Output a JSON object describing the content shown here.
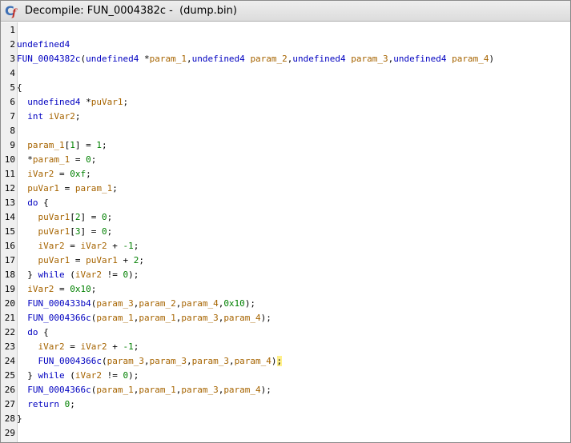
{
  "window": {
    "title": "Decompile: FUN_0004382c -  (dump.bin)",
    "icon": "decompile-icon",
    "icon_letters": [
      "C",
      "f"
    ]
  },
  "editor": {
    "lines": [
      {
        "n": "1",
        "tokens": []
      },
      {
        "n": "2",
        "tokens": [
          {
            "t": "undefined4",
            "c": "type"
          }
        ]
      },
      {
        "n": "3",
        "tokens": [
          {
            "t": "FUN_0004382c",
            "c": "func"
          },
          {
            "t": "(",
            "c": "p"
          },
          {
            "t": "undefined4",
            "c": "type"
          },
          {
            "t": " *",
            "c": "p"
          },
          {
            "t": "param_1",
            "c": "var"
          },
          {
            "t": ",",
            "c": "p"
          },
          {
            "t": "undefined4",
            "c": "type"
          },
          {
            "t": " ",
            "c": "p"
          },
          {
            "t": "param_2",
            "c": "var"
          },
          {
            "t": ",",
            "c": "p"
          },
          {
            "t": "undefined4",
            "c": "type"
          },
          {
            "t": " ",
            "c": "p"
          },
          {
            "t": "param_3",
            "c": "var"
          },
          {
            "t": ",",
            "c": "p"
          },
          {
            "t": "undefined4",
            "c": "type"
          },
          {
            "t": " ",
            "c": "p"
          },
          {
            "t": "param_4",
            "c": "var"
          },
          {
            "t": ")",
            "c": "p"
          }
        ]
      },
      {
        "n": "4",
        "tokens": []
      },
      {
        "n": "5",
        "tokens": [
          {
            "t": "{",
            "c": "p"
          }
        ]
      },
      {
        "n": "6",
        "tokens": [
          {
            "t": "  ",
            "c": "p"
          },
          {
            "t": "undefined4",
            "c": "type"
          },
          {
            "t": " *",
            "c": "p"
          },
          {
            "t": "puVar1",
            "c": "var"
          },
          {
            "t": ";",
            "c": "p"
          }
        ]
      },
      {
        "n": "7",
        "tokens": [
          {
            "t": "  ",
            "c": "p"
          },
          {
            "t": "int",
            "c": "type"
          },
          {
            "t": " ",
            "c": "p"
          },
          {
            "t": "iVar2",
            "c": "var"
          },
          {
            "t": ";",
            "c": "p"
          }
        ]
      },
      {
        "n": "8",
        "tokens": []
      },
      {
        "n": "9",
        "tokens": [
          {
            "t": "  ",
            "c": "p"
          },
          {
            "t": "param_1",
            "c": "var"
          },
          {
            "t": "[",
            "c": "p"
          },
          {
            "t": "1",
            "c": "num"
          },
          {
            "t": "] = ",
            "c": "p"
          },
          {
            "t": "1",
            "c": "num"
          },
          {
            "t": ";",
            "c": "p"
          }
        ]
      },
      {
        "n": "10",
        "tokens": [
          {
            "t": "  *",
            "c": "p"
          },
          {
            "t": "param_1",
            "c": "var"
          },
          {
            "t": " = ",
            "c": "p"
          },
          {
            "t": "0",
            "c": "num"
          },
          {
            "t": ";",
            "c": "p"
          }
        ]
      },
      {
        "n": "11",
        "tokens": [
          {
            "t": "  ",
            "c": "p"
          },
          {
            "t": "iVar2",
            "c": "var"
          },
          {
            "t": " = ",
            "c": "p"
          },
          {
            "t": "0xf",
            "c": "num"
          },
          {
            "t": ";",
            "c": "p"
          }
        ]
      },
      {
        "n": "12",
        "tokens": [
          {
            "t": "  ",
            "c": "p"
          },
          {
            "t": "puVar1",
            "c": "var"
          },
          {
            "t": " = ",
            "c": "p"
          },
          {
            "t": "param_1",
            "c": "var"
          },
          {
            "t": ";",
            "c": "p"
          }
        ]
      },
      {
        "n": "13",
        "tokens": [
          {
            "t": "  ",
            "c": "p"
          },
          {
            "t": "do",
            "c": "kw"
          },
          {
            "t": " {",
            "c": "p"
          }
        ]
      },
      {
        "n": "14",
        "tokens": [
          {
            "t": "    ",
            "c": "p"
          },
          {
            "t": "puVar1",
            "c": "var"
          },
          {
            "t": "[",
            "c": "p"
          },
          {
            "t": "2",
            "c": "num"
          },
          {
            "t": "] = ",
            "c": "p"
          },
          {
            "t": "0",
            "c": "num"
          },
          {
            "t": ";",
            "c": "p"
          }
        ]
      },
      {
        "n": "15",
        "tokens": [
          {
            "t": "    ",
            "c": "p"
          },
          {
            "t": "puVar1",
            "c": "var"
          },
          {
            "t": "[",
            "c": "p"
          },
          {
            "t": "3",
            "c": "num"
          },
          {
            "t": "] = ",
            "c": "p"
          },
          {
            "t": "0",
            "c": "num"
          },
          {
            "t": ";",
            "c": "p"
          }
        ]
      },
      {
        "n": "16",
        "tokens": [
          {
            "t": "    ",
            "c": "p"
          },
          {
            "t": "iVar2",
            "c": "var"
          },
          {
            "t": " = ",
            "c": "p"
          },
          {
            "t": "iVar2",
            "c": "var"
          },
          {
            "t": " + ",
            "c": "p"
          },
          {
            "t": "-1",
            "c": "num"
          },
          {
            "t": ";",
            "c": "p"
          }
        ]
      },
      {
        "n": "17",
        "tokens": [
          {
            "t": "    ",
            "c": "p"
          },
          {
            "t": "puVar1",
            "c": "var"
          },
          {
            "t": " = ",
            "c": "p"
          },
          {
            "t": "puVar1",
            "c": "var"
          },
          {
            "t": " + ",
            "c": "p"
          },
          {
            "t": "2",
            "c": "num"
          },
          {
            "t": ";",
            "c": "p"
          }
        ]
      },
      {
        "n": "18",
        "tokens": [
          {
            "t": "  } ",
            "c": "p"
          },
          {
            "t": "while",
            "c": "kw"
          },
          {
            "t": " (",
            "c": "p"
          },
          {
            "t": "iVar2",
            "c": "var"
          },
          {
            "t": " != ",
            "c": "p"
          },
          {
            "t": "0",
            "c": "num"
          },
          {
            "t": ");",
            "c": "p"
          }
        ]
      },
      {
        "n": "19",
        "tokens": [
          {
            "t": "  ",
            "c": "p"
          },
          {
            "t": "iVar2",
            "c": "var"
          },
          {
            "t": " = ",
            "c": "p"
          },
          {
            "t": "0x10",
            "c": "num"
          },
          {
            "t": ";",
            "c": "p"
          }
        ]
      },
      {
        "n": "20",
        "tokens": [
          {
            "t": "  ",
            "c": "p"
          },
          {
            "t": "FUN_000433b4",
            "c": "func"
          },
          {
            "t": "(",
            "c": "p"
          },
          {
            "t": "param_3",
            "c": "var"
          },
          {
            "t": ",",
            "c": "p"
          },
          {
            "t": "param_2",
            "c": "var"
          },
          {
            "t": ",",
            "c": "p"
          },
          {
            "t": "param_4",
            "c": "var"
          },
          {
            "t": ",",
            "c": "p"
          },
          {
            "t": "0x10",
            "c": "num"
          },
          {
            "t": ");",
            "c": "p"
          }
        ]
      },
      {
        "n": "21",
        "tokens": [
          {
            "t": "  ",
            "c": "p"
          },
          {
            "t": "FUN_0004366c",
            "c": "func"
          },
          {
            "t": "(",
            "c": "p"
          },
          {
            "t": "param_1",
            "c": "var"
          },
          {
            "t": ",",
            "c": "p"
          },
          {
            "t": "param_1",
            "c": "var"
          },
          {
            "t": ",",
            "c": "p"
          },
          {
            "t": "param_3",
            "c": "var"
          },
          {
            "t": ",",
            "c": "p"
          },
          {
            "t": "param_4",
            "c": "var"
          },
          {
            "t": ");",
            "c": "p"
          }
        ]
      },
      {
        "n": "22",
        "tokens": [
          {
            "t": "  ",
            "c": "p"
          },
          {
            "t": "do",
            "c": "kw"
          },
          {
            "t": " {",
            "c": "p"
          }
        ]
      },
      {
        "n": "23",
        "tokens": [
          {
            "t": "    ",
            "c": "p"
          },
          {
            "t": "iVar2",
            "c": "var"
          },
          {
            "t": " = ",
            "c": "p"
          },
          {
            "t": "iVar2",
            "c": "var"
          },
          {
            "t": " + ",
            "c": "p"
          },
          {
            "t": "-1",
            "c": "num"
          },
          {
            "t": ";",
            "c": "p"
          }
        ]
      },
      {
        "n": "24",
        "tokens": [
          {
            "t": "    ",
            "c": "p"
          },
          {
            "t": "FUN_0004366c",
            "c": "func"
          },
          {
            "t": "(",
            "c": "p"
          },
          {
            "t": "param_3",
            "c": "var"
          },
          {
            "t": ",",
            "c": "p"
          },
          {
            "t": "param_3",
            "c": "var"
          },
          {
            "t": ",",
            "c": "p"
          },
          {
            "t": "param_3",
            "c": "var"
          },
          {
            "t": ",",
            "c": "p"
          },
          {
            "t": "param_4",
            "c": "var"
          },
          {
            "t": ")",
            "c": "p"
          },
          {
            "t": ";",
            "c": "hl"
          }
        ]
      },
      {
        "n": "25",
        "tokens": [
          {
            "t": "  } ",
            "c": "p"
          },
          {
            "t": "while",
            "c": "kw"
          },
          {
            "t": " (",
            "c": "p"
          },
          {
            "t": "iVar2",
            "c": "var"
          },
          {
            "t": " != ",
            "c": "p"
          },
          {
            "t": "0",
            "c": "num"
          },
          {
            "t": ");",
            "c": "p"
          }
        ]
      },
      {
        "n": "26",
        "tokens": [
          {
            "t": "  ",
            "c": "p"
          },
          {
            "t": "FUN_0004366c",
            "c": "func"
          },
          {
            "t": "(",
            "c": "p"
          },
          {
            "t": "param_1",
            "c": "var"
          },
          {
            "t": ",",
            "c": "p"
          },
          {
            "t": "param_1",
            "c": "var"
          },
          {
            "t": ",",
            "c": "p"
          },
          {
            "t": "param_3",
            "c": "var"
          },
          {
            "t": ",",
            "c": "p"
          },
          {
            "t": "param_4",
            "c": "var"
          },
          {
            "t": ");",
            "c": "p"
          }
        ]
      },
      {
        "n": "27",
        "tokens": [
          {
            "t": "  ",
            "c": "p"
          },
          {
            "t": "return",
            "c": "kw"
          },
          {
            "t": " ",
            "c": "p"
          },
          {
            "t": "0",
            "c": "num"
          },
          {
            "t": ";",
            "c": "p"
          }
        ]
      },
      {
        "n": "28",
        "tokens": [
          {
            "t": "}",
            "c": "p"
          }
        ]
      },
      {
        "n": "29",
        "tokens": []
      }
    ]
  }
}
